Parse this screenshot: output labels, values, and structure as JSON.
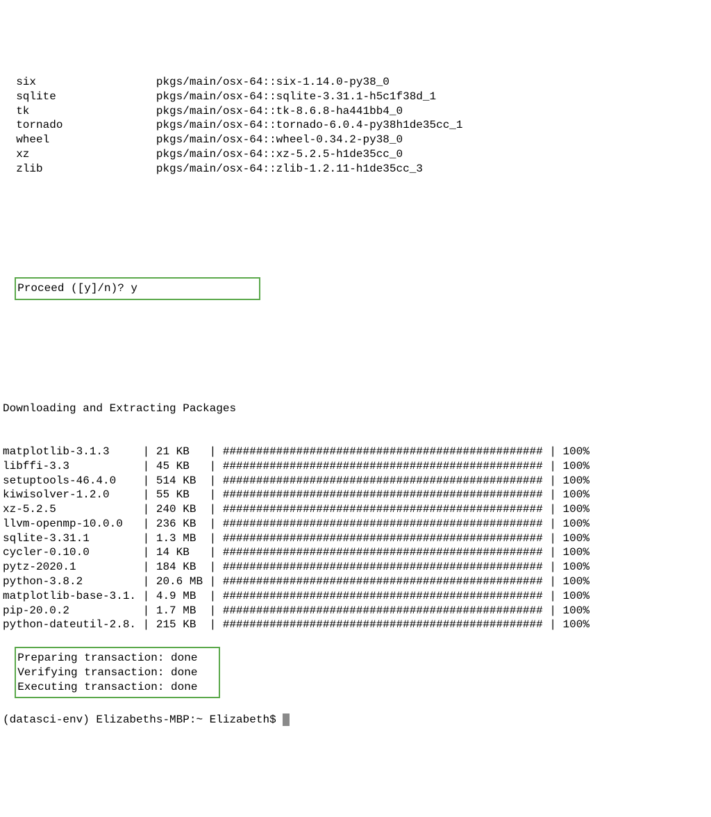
{
  "packages_list": [
    {
      "name": "six",
      "spec": "pkgs/main/osx-64::six-1.14.0-py38_0"
    },
    {
      "name": "sqlite",
      "spec": "pkgs/main/osx-64::sqlite-3.31.1-h5c1f38d_1"
    },
    {
      "name": "tk",
      "spec": "pkgs/main/osx-64::tk-8.6.8-ha441bb4_0"
    },
    {
      "name": "tornado",
      "spec": "pkgs/main/osx-64::tornado-6.0.4-py38h1de35cc_1"
    },
    {
      "name": "wheel",
      "spec": "pkgs/main/osx-64::wheel-0.34.2-py38_0"
    },
    {
      "name": "xz",
      "spec": "pkgs/main/osx-64::xz-5.2.5-h1de35cc_0"
    },
    {
      "name": "zlib",
      "spec": "pkgs/main/osx-64::zlib-1.2.11-h1de35cc_3"
    }
  ],
  "proceed_prompt": "Proceed ([y]/n)? y",
  "download_heading": "Downloading and Extracting Packages",
  "downloads": [
    {
      "name": "matplotlib-3.1.3    ",
      "size": "21 KB  ",
      "bar": "################################################",
      "pct": "100%"
    },
    {
      "name": "libffi-3.3          ",
      "size": "45 KB  ",
      "bar": "################################################",
      "pct": "100%"
    },
    {
      "name": "setuptools-46.4.0   ",
      "size": "514 KB ",
      "bar": "################################################",
      "pct": "100%"
    },
    {
      "name": "kiwisolver-1.2.0    ",
      "size": "55 KB  ",
      "bar": "################################################",
      "pct": "100%"
    },
    {
      "name": "xz-5.2.5            ",
      "size": "240 KB ",
      "bar": "################################################",
      "pct": "100%"
    },
    {
      "name": "llvm-openmp-10.0.0  ",
      "size": "236 KB ",
      "bar": "################################################",
      "pct": "100%"
    },
    {
      "name": "sqlite-3.31.1       ",
      "size": "1.3 MB ",
      "bar": "################################################",
      "pct": "100%"
    },
    {
      "name": "cycler-0.10.0       ",
      "size": "14 KB  ",
      "bar": "################################################",
      "pct": "100%"
    },
    {
      "name": "pytz-2020.1         ",
      "size": "184 KB ",
      "bar": "################################################",
      "pct": "100%"
    },
    {
      "name": "python-3.8.2        ",
      "size": "20.6 MB",
      "bar": "################################################",
      "pct": "100%"
    },
    {
      "name": "matplotlib-base-3.1.",
      "size": "4.9 MB ",
      "bar": "################################################",
      "pct": "100%"
    },
    {
      "name": "pip-20.0.2          ",
      "size": "1.7 MB ",
      "bar": "################################################",
      "pct": "100%"
    },
    {
      "name": "python-dateutil-2.8.",
      "size": "215 KB ",
      "bar": "################################################",
      "pct": "100%"
    }
  ],
  "transactions": [
    "Preparing transaction: done",
    "Verifying transaction: done",
    "Executing transaction: done"
  ],
  "prompt": "(datasci-env) Elizabeths-MBP:~ Elizabeth$ "
}
